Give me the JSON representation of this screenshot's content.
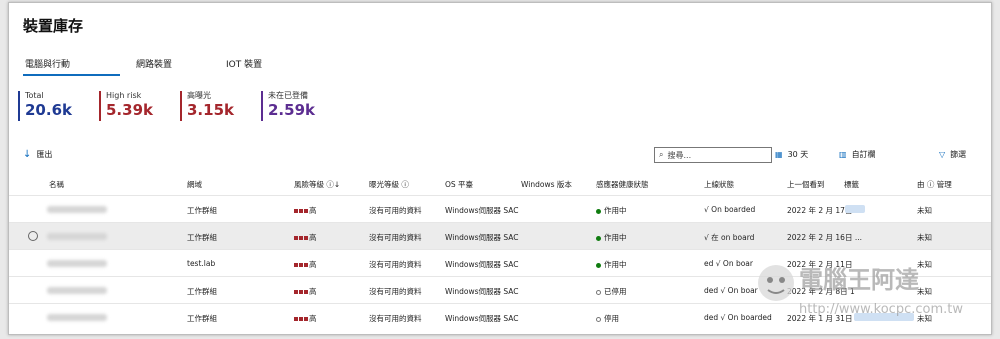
{
  "page": {
    "title": "裝置庫存"
  },
  "tabs": [
    {
      "label": "電腦與行動"
    },
    {
      "label": "網路裝置"
    },
    {
      "label": "IOT 裝置"
    }
  ],
  "stats": [
    {
      "label": "Total",
      "value": "20.6k",
      "color": "#1f3a93"
    },
    {
      "label": "High risk",
      "value": "5.39k",
      "color": "#a4262c"
    },
    {
      "label": "高曝光",
      "value": "3.15k",
      "color": "#a4262c"
    },
    {
      "label": "未在已登備",
      "value": "2.59k",
      "color": "#5c2d91"
    }
  ],
  "toolbar": {
    "export_label": "匯出",
    "search_placeholder": "搜尋...",
    "days_label": "30 天",
    "customize_label": "自訂欄",
    "filter_label": "篩選"
  },
  "table": {
    "headers": [
      "名稱",
      "網域",
      "風險等級 ⓘ↓",
      "曝光等級 ⓘ",
      "OS 平臺",
      "Windows 版本",
      "感應器健康狀態",
      "上線狀態",
      "上一個看到",
      "標籤",
      "由 ⓘ 管理"
    ],
    "rows": [
      {
        "domain": "工作群組",
        "risk": "高",
        "exposure": "沒有可用的資料",
        "os": "Windows伺服器 SAC",
        "health": "作用中",
        "health_on": true,
        "onboard": "√ On boarded",
        "last_seen": "2022 年 2 月 17日",
        "managed": "未知"
      },
      {
        "domain": "工作群組",
        "risk": "高",
        "exposure": "沒有可用的資料",
        "os": "Windows伺服器 SAC",
        "health": "作用中",
        "health_on": true,
        "onboard": "√ 在 on board",
        "last_seen": "2022 年 2 月 16日 ...",
        "managed": "未知"
      },
      {
        "domain": "test.lab",
        "risk": "高",
        "exposure": "沒有可用的資料",
        "os": "Windows伺服器 SAC",
        "health": "作用中",
        "health_on": true,
        "onboard": "ed √ On boar",
        "last_seen": "2022 年 2 月 11日",
        "managed": "未知"
      },
      {
        "domain": "工作群組",
        "risk": "高",
        "exposure": "沒有可用的資料",
        "os": "Windows伺服器 SAC",
        "health": "已停用",
        "health_on": false,
        "onboard": "ded √ On boar",
        "last_seen": "2022 年 2 月 8日 1",
        "managed": "未知"
      },
      {
        "domain": "工作群組",
        "risk": "高",
        "exposure": "沒有可用的資料",
        "os": "Windows伺服器 SAC",
        "health": "停用",
        "health_on": false,
        "onboard": "ded √ On boarded",
        "last_seen": "2022 年 1 月 31日 ...",
        "managed": "未知"
      }
    ]
  },
  "watermark": {
    "title": "電腦王阿達",
    "url": "http://www.kocpc.com.tw"
  }
}
